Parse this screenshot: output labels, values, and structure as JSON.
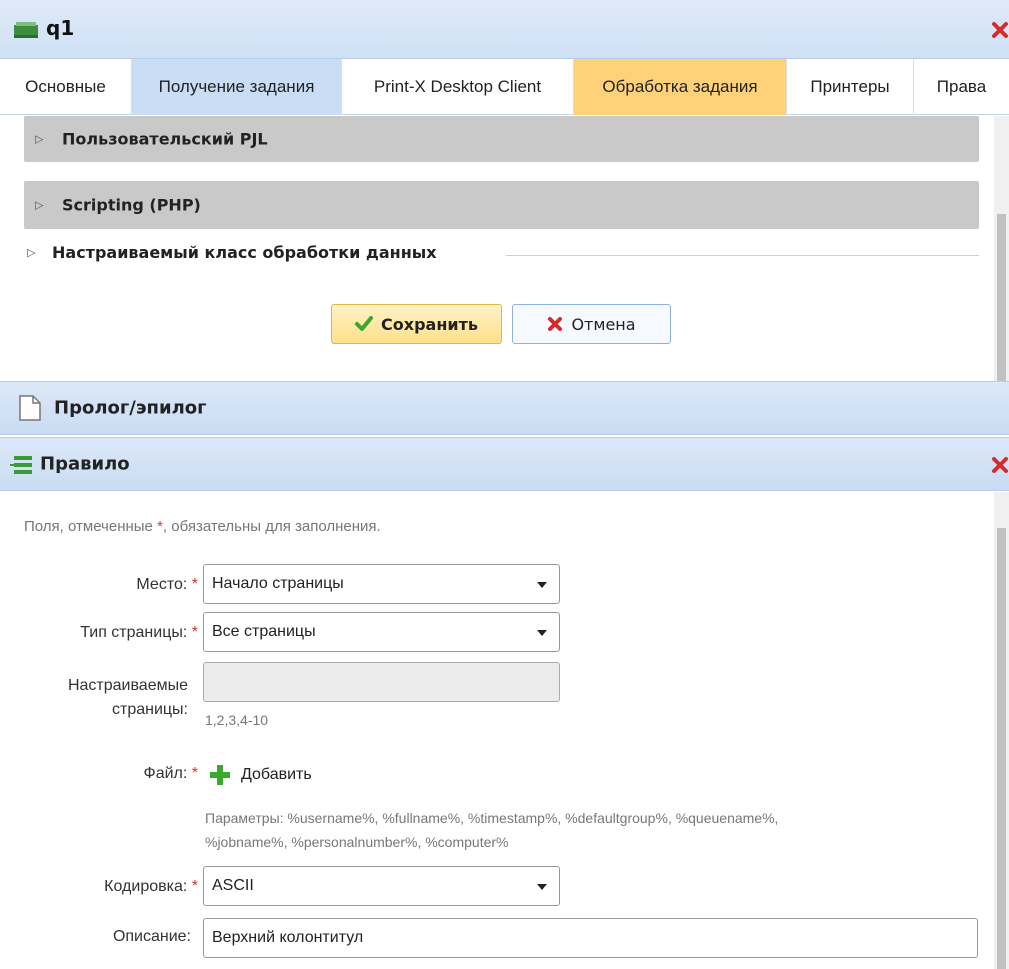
{
  "window": {
    "title": "q1"
  },
  "tabs": [
    {
      "label": "Основные"
    },
    {
      "label": "Получение задания"
    },
    {
      "label": "Print-X Desktop Client"
    },
    {
      "label": "Обработка задания"
    },
    {
      "label": "Принтеры"
    },
    {
      "label": "Права"
    }
  ],
  "sections": {
    "custom_pjl": "Пользовательский PJL",
    "scripting": "Scripting (PHP)",
    "custom_class": "Настраиваемый класс обработки данных"
  },
  "buttons": {
    "save": "Сохранить",
    "cancel": "Отмена"
  },
  "panels": {
    "prolog": "Пролог/эпилог",
    "rule": "Правило"
  },
  "form": {
    "note_before": "Поля, отмеченные ",
    "note_star": "*",
    "note_after": ", обязательны для заполнения.",
    "required_star": "*",
    "place_label": "Место:",
    "place_value": "Начало страницы",
    "page_type_label": "Тип страницы:",
    "page_type_value": "Все страницы",
    "custom_pages_label_1": "Настраиваемые",
    "custom_pages_label_2": "страницы:",
    "custom_pages_hint": "1,2,3,4-10",
    "file_label": "Файл:",
    "add_label": "Добавить",
    "params_line_1": "Параметры: %username%, %fullname%, %timestamp%, %defaultgroup%, %queuename%,",
    "params_line_2": "%jobname%, %personalnumber%, %computer%",
    "encoding_label": "Кодировка:",
    "encoding_value": "ASCII",
    "description_label": "Описание:",
    "description_value": "Верхний колонтитул"
  },
  "colors": {
    "active_tab": "#c9ddf5",
    "highlight_tab": "#ffd27a",
    "required_star": "#dd3333",
    "close_red": "#d62b2b",
    "add_green": "#3aa82f"
  }
}
